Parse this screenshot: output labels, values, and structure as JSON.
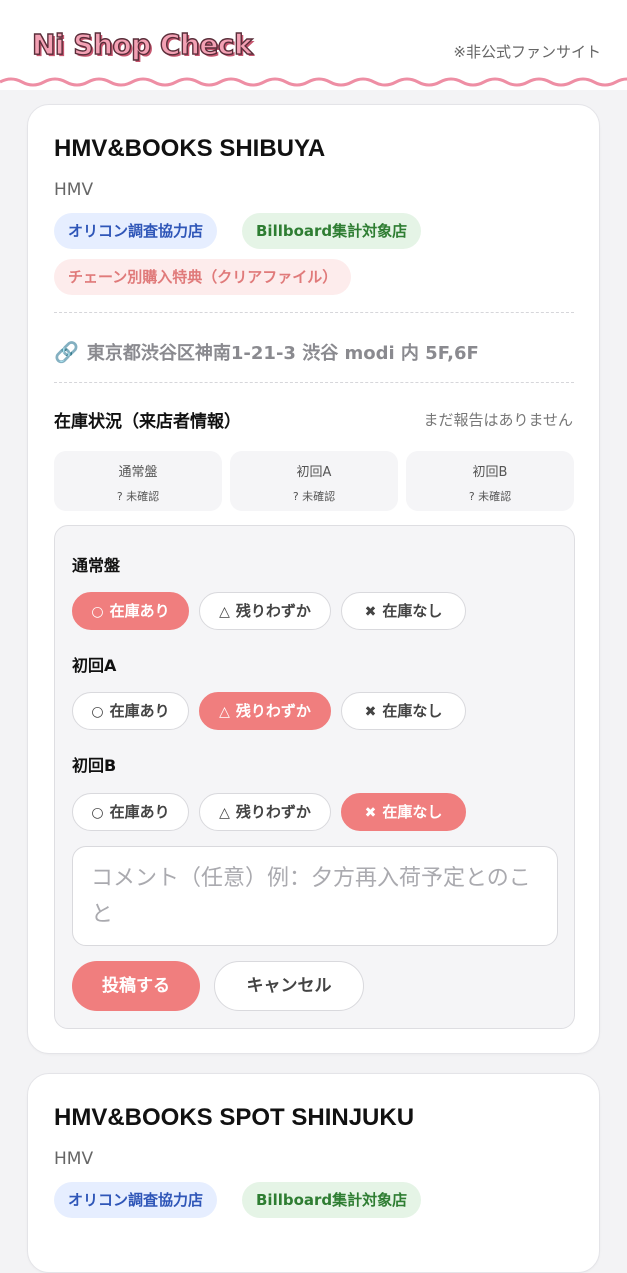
{
  "header": {
    "logo_text": "Ni Shop Check",
    "fan_note": "※非公式ファンサイト"
  },
  "colors": {
    "accent": "#f07e7e",
    "logo_pink": "#f3a1b4",
    "tag_blue": "#2f56b8",
    "tag_green": "#2e7d32",
    "tag_pink": "#e07a7a"
  },
  "stores": [
    {
      "name": "HMV&BOOKS SHIBUYA",
      "chain": "HMV",
      "tags": [
        "オリコン調査協力店",
        "Billboard集計対象店",
        "チェーン別購入特典（クリアファイル）"
      ],
      "address_icon": "link-icon",
      "address": "東京都渋谷区神南1-21-3 渋谷 modi 内 5F,6F",
      "stock_title": "在庫状況（来店者情報）",
      "no_report": "まだ報告はありません",
      "summary": [
        {
          "edition": "通常盤",
          "state": "? 未確認"
        },
        {
          "edition": "初回A",
          "state": "? 未確認"
        },
        {
          "edition": "初回B",
          "state": "? 未確認"
        }
      ],
      "form": {
        "editions": [
          {
            "label": "通常盤",
            "selected": "在庫あり"
          },
          {
            "label": "初回A",
            "selected": "残りわずか"
          },
          {
            "label": "初回B",
            "selected": "在庫なし"
          }
        ],
        "options": [
          {
            "glyph": "○",
            "label": "在庫あり"
          },
          {
            "glyph": "△",
            "label": "残りわずか"
          },
          {
            "glyph": "✖",
            "label": "在庫なし"
          }
        ],
        "comment_placeholder": "コメント（任意）例：夕方再入荷予定とのこと",
        "post_label": "投稿する",
        "cancel_label": "キャンセル"
      }
    },
    {
      "name": "HMV&BOOKS SPOT SHINJUKU",
      "chain": "HMV",
      "tags": [
        "オリコン調査協力店",
        "Billboard集計対象店"
      ]
    }
  ]
}
